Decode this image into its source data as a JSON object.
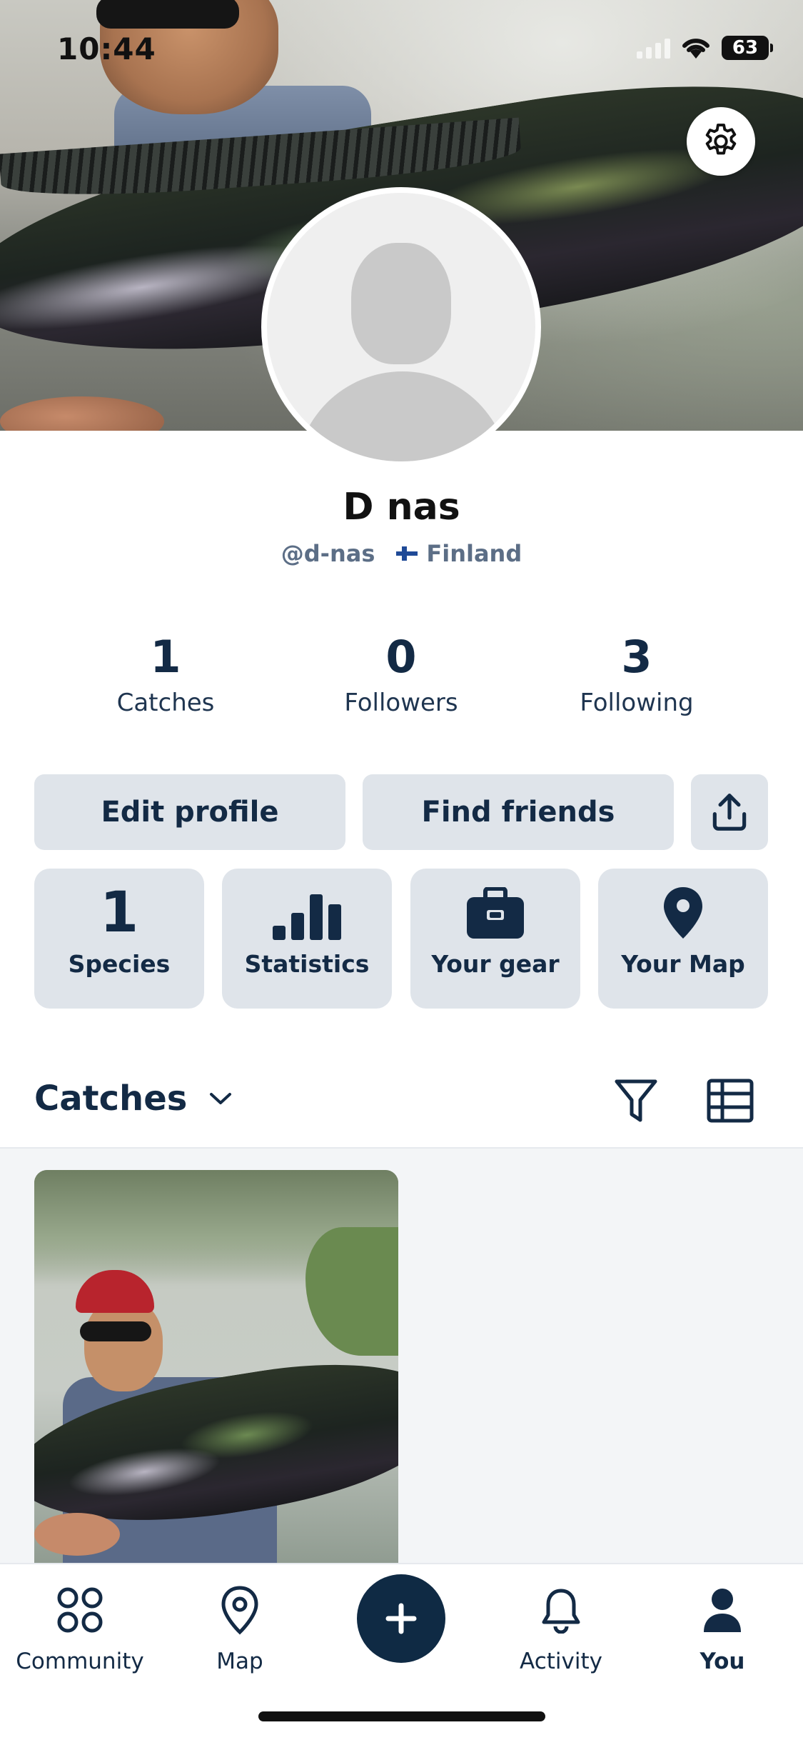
{
  "status_bar": {
    "time": "10:44",
    "battery": "63"
  },
  "profile": {
    "name": "D nas",
    "handle": "@d-nas",
    "country": "Finland"
  },
  "stats": [
    {
      "value": "1",
      "label": "Catches"
    },
    {
      "value": "0",
      "label": "Followers"
    },
    {
      "value": "3",
      "label": "Following"
    }
  ],
  "actions": {
    "edit_profile": "Edit profile",
    "find_friends": "Find friends"
  },
  "tiles": [
    {
      "value": "1",
      "label": "Species"
    },
    {
      "label": "Statistics",
      "icon": "bar-chart-icon"
    },
    {
      "label": "Your gear",
      "icon": "toolbox-icon"
    },
    {
      "label": "Your Map",
      "icon": "map-pin-icon"
    }
  ],
  "catches_section": {
    "title": "Catches"
  },
  "tabbar": {
    "items": [
      {
        "label": "Community",
        "icon": "community-icon"
      },
      {
        "label": "Map",
        "icon": "map-pin-icon"
      },
      {
        "label": "Activity",
        "icon": "bell-icon"
      },
      {
        "label": "You",
        "icon": "user-icon",
        "active": true
      }
    ]
  },
  "colors": {
    "primary": "#132a45",
    "button_bg": "#dfe4ea",
    "fab": "#0f2a44"
  }
}
